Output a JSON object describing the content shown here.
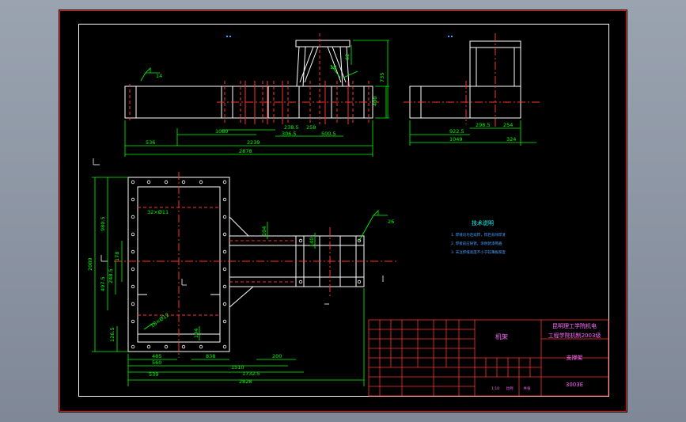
{
  "colors": {
    "background": "#000000",
    "frame": "#ffffff",
    "border": "#ff2020",
    "outline": "#ffffff",
    "dimension": "#00ff00",
    "centerline": "#ff3030",
    "hidden": "#ff3030",
    "note": "#00ffff",
    "title_text": "#ff66ff",
    "table_lines": "#ff3030",
    "ucs": "#ffffff"
  },
  "front_view": {
    "dims": {
      "d536": "536",
      "d1080": "1080",
      "d2239": "2239",
      "d2878": "2878",
      "d2385": "238.5",
      "d258": "258",
      "d3065": "306.5",
      "d5005": "500.5",
      "d400": "400",
      "d735": "735",
      "d62": "62",
      "d18": "18",
      "d14": "14"
    },
    "weld_14": "14"
  },
  "side_view": {
    "dims": {
      "d9225": "922.5",
      "d2985": "298.5",
      "d254": "254",
      "d1049": "1049",
      "d324": "324"
    }
  },
  "plan_view": {
    "dims": {
      "d32x11": "32×Ø11",
      "d18x12": "18×Ø12",
      "d980": "980.5",
      "d2089": "2089",
      "d4975": "497.5",
      "d1265": "126.5",
      "d1785": "178",
      "d2485": "248.5",
      "d104a": "104",
      "d104b": "104",
      "d140": "140",
      "d485": "485",
      "d560": "560",
      "d539": "539",
      "d838": "838",
      "d1510": "1510",
      "d200": "200",
      "d1732": "1732.5",
      "d2828": "2828"
    },
    "weld_26": "26"
  },
  "notes": {
    "title": "技术说明",
    "lines": [
      "1. 焊缝均为连续焊，焊后去除焊渣",
      "2. 焊接前应除锈，涂防锈漆两遍",
      "3. 未注焊缝高度不小于较薄板厚度"
    ]
  },
  "title_block": {
    "part_name": "机架",
    "school_line1": "昆明理工学院机电",
    "school_line2": "工程学院机制2003级",
    "drawing_name": "支撑架",
    "drawing_no": "3003E",
    "scale_labels": [
      "1:10",
      "比例",
      "共张"
    ]
  }
}
